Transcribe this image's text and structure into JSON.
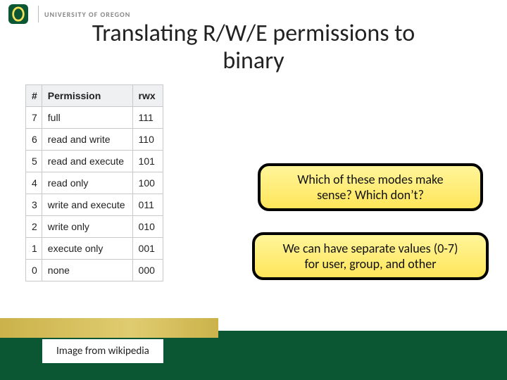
{
  "header": {
    "university": "UNIVERSITY OF OREGON"
  },
  "title_line1": "Translating R/W/E permissions to",
  "title_line2": "binary",
  "table": {
    "headers": {
      "num": "#",
      "permission": "Permission",
      "rwx": "rwx"
    },
    "rows": [
      {
        "num": "7",
        "permission": "full",
        "rwx": "111"
      },
      {
        "num": "6",
        "permission": "read and write",
        "rwx": "110"
      },
      {
        "num": "5",
        "permission": "read and execute",
        "rwx": "101"
      },
      {
        "num": "4",
        "permission": "read only",
        "rwx": "100"
      },
      {
        "num": "3",
        "permission": "write and execute",
        "rwx": "011"
      },
      {
        "num": "2",
        "permission": "write only",
        "rwx": "010"
      },
      {
        "num": "1",
        "permission": "execute only",
        "rwx": "001"
      },
      {
        "num": "0",
        "permission": "none",
        "rwx": "000"
      }
    ]
  },
  "callout1_line1": "Which of these modes make",
  "callout1_line2": "sense?  Which don’t?",
  "callout2_line1": "We can have separate values (0-7)",
  "callout2_line2": "for user, group, and other",
  "credit": "Image from wikipedia"
}
